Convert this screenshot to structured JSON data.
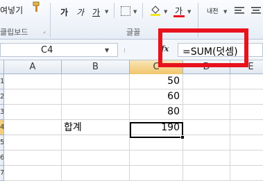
{
  "ribbon": {
    "clipboard": {
      "paste_label": "여넣기",
      "group_label": "클립보드",
      "brush_icon": "format-painter-icon"
    },
    "font": {
      "bold_label": "가",
      "italic_label": "가",
      "underline_label": "가",
      "font_color_label": "가",
      "font_color": "#e8121d",
      "fill_color": "#f4e51c",
      "group_label": "글꼴"
    },
    "alignment": {
      "wrap_label": "내천"
    }
  },
  "formula_bar": {
    "name_box": "C4",
    "fx_label": "fx",
    "formula": "=SUM(덧셈)"
  },
  "columns": [
    "A",
    "B",
    "C",
    "D",
    "E"
  ],
  "rows": [
    "1",
    "2",
    "3",
    "4",
    "5",
    "6",
    "7"
  ],
  "cells": {
    "C1": "50",
    "C2": "60",
    "C3": "80",
    "B4": "합계",
    "C4": "190"
  },
  "selected_cell": "C4",
  "highlight_color": "#e8121d"
}
